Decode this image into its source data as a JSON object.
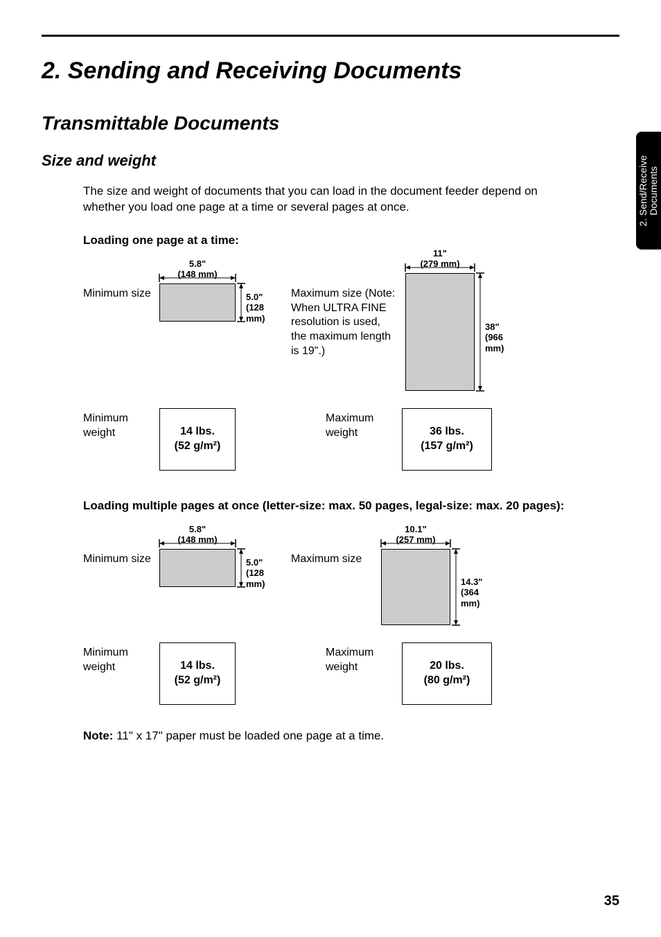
{
  "chapter": "2.  Sending and Receiving Documents",
  "section": "Transmittable Documents",
  "subsection": "Size and weight",
  "intro": "The size and weight of documents that you can load in the document feeder depend on whether you load one page at a time or several pages at once.",
  "loading_one": "Loading one page at a time:",
  "single": {
    "min_size_label": "Minimum size",
    "min_w": "5.8\"",
    "min_w_mm": "(148 mm)",
    "min_h": "5.0\"",
    "min_h_mm": "(128 mm)",
    "max_size_label": "Maximum size (Note: When ULTRA FINE resolution is used, the maximum length is 19\".)",
    "max_w": "11\"",
    "max_w_mm": "(279 mm)",
    "max_h": "38\"",
    "max_h_mm": "(966 mm)",
    "min_weight_label": "Minimum weight",
    "min_weight": "14 lbs.",
    "min_weight_g": "(52 g/m²)",
    "max_weight_label": "Maximum weight",
    "max_weight": "36 lbs.",
    "max_weight_g": "(157 g/m²)"
  },
  "loading_multi": "Loading multiple pages at once (letter-size: max. 50 pages, legal-size: max. 20 pages):",
  "multi": {
    "min_size_label": "Minimum size",
    "min_w": "5.8\"",
    "min_w_mm": "(148 mm)",
    "min_h": "5.0\"",
    "min_h_mm": "(128 mm)",
    "max_size_label": "Maximum size",
    "max_w": "10.1\"",
    "max_w_mm": "(257 mm)",
    "max_h": "14.3\"",
    "max_h_mm": "(364 mm)",
    "min_weight_label": "Minimum weight",
    "min_weight": "14 lbs.",
    "min_weight_g": "(52 g/m²)",
    "max_weight_label": "Maximum weight",
    "max_weight": "20 lbs.",
    "max_weight_g": "(80 g/m²)"
  },
  "note_label": "Note:",
  "note": " 11\" x 17\" paper must be loaded one page at a time.",
  "page_number": "35",
  "side_tab": "2. Send/Receive\nDocuments"
}
